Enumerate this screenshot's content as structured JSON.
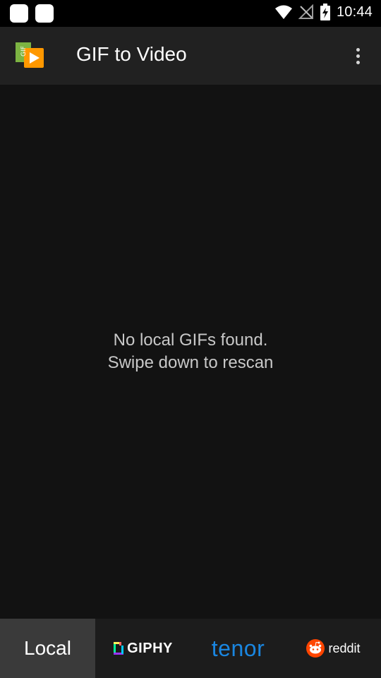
{
  "status_bar": {
    "time": "10:44",
    "icons": [
      "wifi-icon",
      "signal-off-icon",
      "battery-charging-icon"
    ]
  },
  "appbar": {
    "title": "GIF to Video",
    "logo_icon": "gif-video-logo-icon",
    "logo_text": "GIF",
    "menu_icon": "overflow-menu-icon"
  },
  "content": {
    "empty_line1": "No local GIFs found.",
    "empty_line2": "Swipe down to rescan"
  },
  "tabs": [
    {
      "id": "local",
      "label": "Local",
      "active": true
    },
    {
      "id": "giphy",
      "label": "GIPHY",
      "icon": "giphy-logo-icon"
    },
    {
      "id": "tenor",
      "label": "tenor"
    },
    {
      "id": "reddit",
      "label": "reddit",
      "icon": "reddit-logo-icon"
    }
  ],
  "colors": {
    "background": "#121212",
    "appbar": "#212121",
    "tabbar": "#1c1c1c",
    "tab_active": "#3a3a3a",
    "tenor_blue": "#1a86e0",
    "reddit_orange": "#ff4500"
  }
}
